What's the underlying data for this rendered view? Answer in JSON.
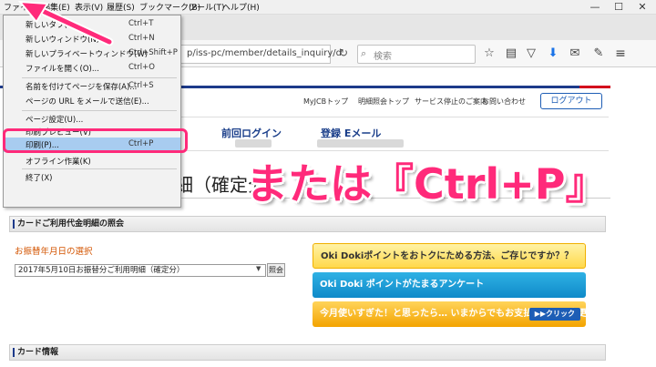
{
  "menubar": {
    "items": [
      "ファイル(F)",
      "編集(E)",
      "表示(V)",
      "履歴(S)",
      "ブックマーク(B)",
      "ツール(T)",
      "ヘルプ(H)"
    ],
    "window_controls": [
      "—",
      "☐",
      "✕"
    ]
  },
  "navbar": {
    "url": "p/iss-pc/member/details_inquiry/d",
    "search_placeholder": "検索"
  },
  "file_menu": {
    "items": [
      {
        "label": "新しいタブ(T)",
        "shortcut": "Ctrl+T"
      },
      {
        "label": "新しいウィンドウ(N)",
        "shortcut": "Ctrl+N"
      },
      {
        "label": "新しいプライベートウィンドウ(W)",
        "shortcut": "Ctrl+Shift+P"
      },
      {
        "label": "ファイルを開く(O)...",
        "shortcut": "Ctrl+O"
      },
      {
        "label": "名前を付けてページを保存(A)...",
        "shortcut": "Ctrl+S"
      },
      {
        "label": "ページの URL をメールで送信(E)...",
        "shortcut": ""
      },
      {
        "label": "ページ設定(U)...",
        "shortcut": ""
      },
      {
        "label": "印刷プレビュー(V)",
        "shortcut": ""
      },
      {
        "label": "印刷(P)...",
        "shortcut": "Ctrl+P"
      },
      {
        "label": "オフライン作業(K)",
        "shortcut": ""
      },
      {
        "label": "終了(X)",
        "shortcut": ""
      }
    ]
  },
  "page": {
    "top_links": [
      "MyJCBトップ",
      "明細照会トップ",
      "サービス停止のご案内",
      "お問い合わせ"
    ],
    "logout_label": "ログアウト",
    "nav": {
      "last_login": "前回ログイン",
      "email": "登録 Eメール"
    },
    "title": "カードご利用代金明細（確定分）",
    "section1": "カードご利用代金明細の照会",
    "date_select_label": "お振替年月日の選択",
    "date_selected": "2017年5月10日お振替分ご利用明細（確定分）",
    "view_button": "照会",
    "banner1": "Oki Dokiポイントをおトクにためる方法、ご存じですか？？",
    "banner2": "Oki Doki ポイントがたまるアンケート",
    "banner3": "今月使いすぎた！と思ったら… いまからでもお支払い金額を変更できます！",
    "banner3_button": "▶▶クリック",
    "section2": "カード情報"
  },
  "overlay": {
    "caption": "または『Ctrl+P』",
    "accent_color": "#ff2a7a"
  }
}
